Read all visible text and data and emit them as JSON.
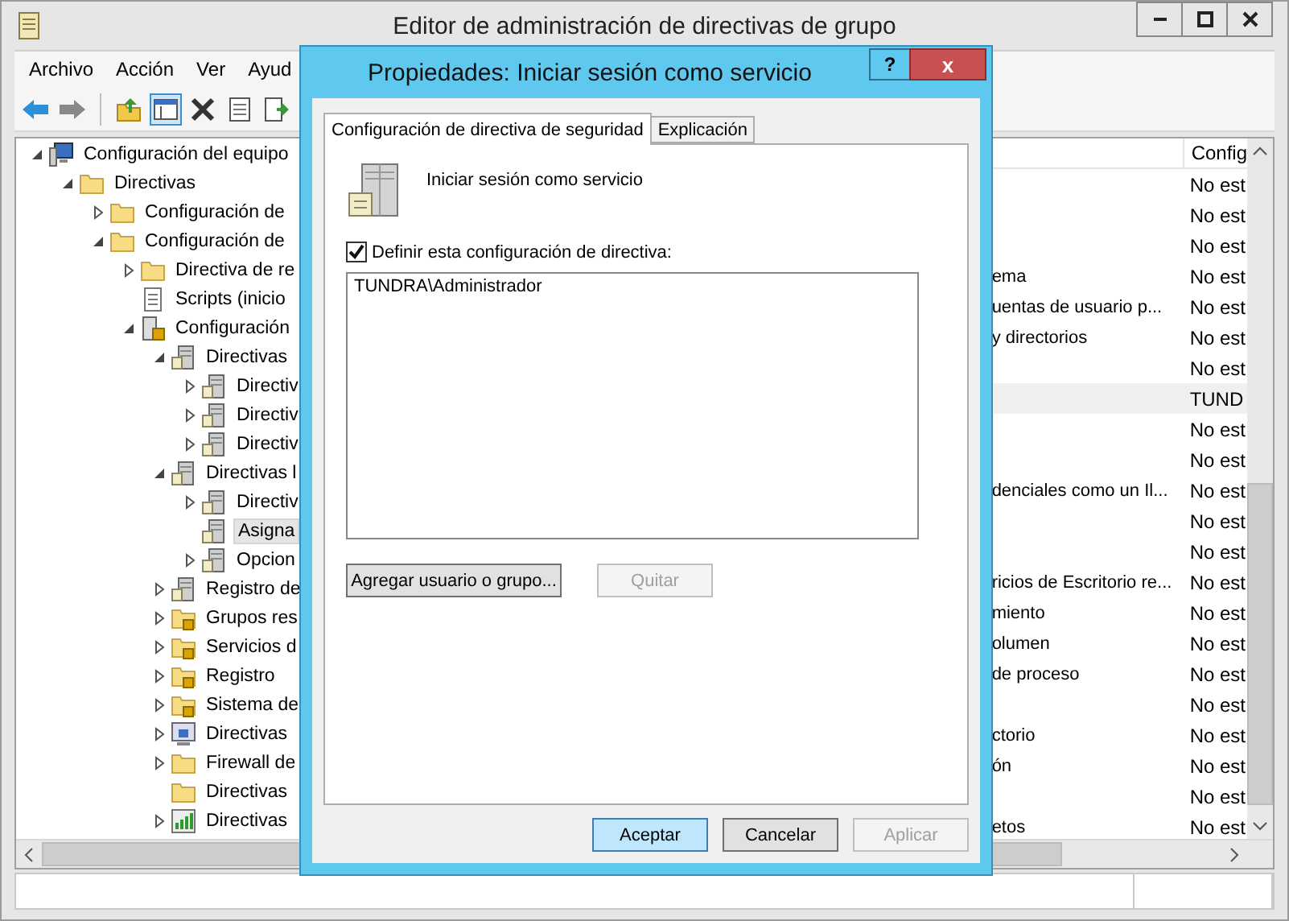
{
  "window": {
    "title": "Editor de administración de directivas de grupo"
  },
  "menu": [
    "Archivo",
    "Acción",
    "Ver",
    "Ayud"
  ],
  "toolbar": [
    {
      "kind": "back",
      "pressed": false
    },
    {
      "kind": "forward",
      "pressed": false
    },
    {
      "kind": "separator"
    },
    {
      "kind": "up",
      "pressed": false
    },
    {
      "kind": "tree",
      "pressed": true
    },
    {
      "kind": "delete",
      "pressed": false
    },
    {
      "kind": "properties",
      "pressed": false
    },
    {
      "kind": "export",
      "pressed": false
    }
  ],
  "tree": [
    {
      "label": "Configuración del equipo",
      "kind": "computer",
      "expanded": true,
      "selected": false,
      "children": [
        {
          "label": "Directivas",
          "kind": "folder",
          "expanded": true,
          "selected": false,
          "children": [
            {
              "label": "Configuración de",
              "kind": "folder",
              "expanded": false,
              "selected": false
            },
            {
              "label": "Configuración de",
              "kind": "folder",
              "expanded": true,
              "selected": false,
              "children": [
                {
                  "label": "Directiva de re",
                  "kind": "folder",
                  "expanded": false,
                  "selected": false
                },
                {
                  "label": "Scripts (inicio",
                  "kind": "script",
                  "selected": false
                },
                {
                  "label": "Configuración",
                  "kind": "lockdoc",
                  "expanded": true,
                  "selected": false,
                  "children": [
                    {
                      "label": "Directivas",
                      "kind": "server",
                      "expanded": true,
                      "selected": false,
                      "children": [
                        {
                          "label": "Directiv",
                          "kind": "server",
                          "expanded": false,
                          "selected": false
                        },
                        {
                          "label": "Directiv",
                          "kind": "server",
                          "expanded": false,
                          "selected": false
                        },
                        {
                          "label": "Directiv",
                          "kind": "server",
                          "expanded": false,
                          "selected": false
                        }
                      ]
                    },
                    {
                      "label": "Directivas l",
                      "kind": "server",
                      "expanded": true,
                      "selected": false,
                      "children": [
                        {
                          "label": "Directiv",
                          "kind": "server",
                          "expanded": false,
                          "selected": false
                        },
                        {
                          "label": "Asigna",
                          "kind": "server",
                          "selected": true
                        },
                        {
                          "label": "Opcion",
                          "kind": "server",
                          "expanded": false,
                          "selected": false
                        }
                      ]
                    },
                    {
                      "label": "Registro de",
                      "kind": "server",
                      "expanded": false,
                      "selected": false
                    },
                    {
                      "label": "Grupos res",
                      "kind": "lockfolder",
                      "expanded": false,
                      "selected": false
                    },
                    {
                      "label": "Servicios d",
                      "kind": "lockfolder",
                      "expanded": false,
                      "selected": false
                    },
                    {
                      "label": "Registro",
                      "kind": "lockfolder",
                      "expanded": false,
                      "selected": false
                    },
                    {
                      "label": "Sistema de",
                      "kind": "lockfolder",
                      "expanded": false,
                      "selected": false
                    },
                    {
                      "label": "Directivas",
                      "kind": "monitor",
                      "expanded": false,
                      "selected": false
                    },
                    {
                      "label": "Firewall de",
                      "kind": "folder",
                      "expanded": false,
                      "selected": false
                    },
                    {
                      "label": "Directivas",
                      "kind": "folder",
                      "selected": false
                    },
                    {
                      "label": "Directivas",
                      "kind": "chart",
                      "expanded": false,
                      "selected": false
                    }
                  ]
                }
              ]
            }
          ]
        }
      ]
    }
  ],
  "list": {
    "columns": [
      "Config"
    ],
    "rows": [
      {
        "name": "",
        "value": "No est",
        "selected": false
      },
      {
        "name": "",
        "value": "No est",
        "selected": false
      },
      {
        "name": "",
        "value": "No est",
        "selected": false
      },
      {
        "name": "ema",
        "value": "No est",
        "selected": false
      },
      {
        "name": "uentas de usuario p...",
        "value": "No est",
        "selected": false
      },
      {
        "name": "y directorios",
        "value": "No est",
        "selected": false
      },
      {
        "name": "",
        "value": "No est",
        "selected": false
      },
      {
        "name": "",
        "value": "TUND",
        "selected": true
      },
      {
        "name": "",
        "value": "No est",
        "selected": false
      },
      {
        "name": "",
        "value": "No est",
        "selected": false
      },
      {
        "name": "denciales como un Il...",
        "value": "No est",
        "selected": false
      },
      {
        "name": "",
        "value": "No est",
        "selected": false
      },
      {
        "name": "",
        "value": "No est",
        "selected": false
      },
      {
        "name": "ricios de Escritorio re...",
        "value": "No est",
        "selected": false
      },
      {
        "name": "miento",
        "value": "No est",
        "selected": false
      },
      {
        "name": "olumen",
        "value": "No est",
        "selected": false
      },
      {
        "name": "de proceso",
        "value": "No est",
        "selected": false
      },
      {
        "name": "",
        "value": "No est",
        "selected": false
      },
      {
        "name": "ctorio",
        "value": "No est",
        "selected": false
      },
      {
        "name": "ón",
        "value": "No est",
        "selected": false
      },
      {
        "name": "",
        "value": "No est",
        "selected": false
      },
      {
        "name": "etos",
        "value": "No est",
        "selected": false
      }
    ]
  },
  "dialog": {
    "title": "Propiedades: Iniciar sesión como servicio",
    "help": "?",
    "close": "x",
    "tabs": [
      {
        "label": "Configuración de directiva de seguridad",
        "selected": true
      },
      {
        "label": "Explicación",
        "selected": false
      }
    ],
    "policy_name": "Iniciar sesión como servicio",
    "define": {
      "label": "Definir esta configuración de directiva:",
      "checked": true
    },
    "accounts": [
      "TUNDRA\\Administrador"
    ],
    "list_buttons": [
      {
        "label": "Agregar usuario o grupo...",
        "disabled": false
      },
      {
        "label": "Quitar",
        "disabled": true
      }
    ],
    "buttons": [
      {
        "label": "Aceptar",
        "default": true,
        "disabled": false
      },
      {
        "label": "Cancelar",
        "default": false,
        "disabled": false
      },
      {
        "label": "Aplicar",
        "default": false,
        "disabled": true
      }
    ]
  }
}
